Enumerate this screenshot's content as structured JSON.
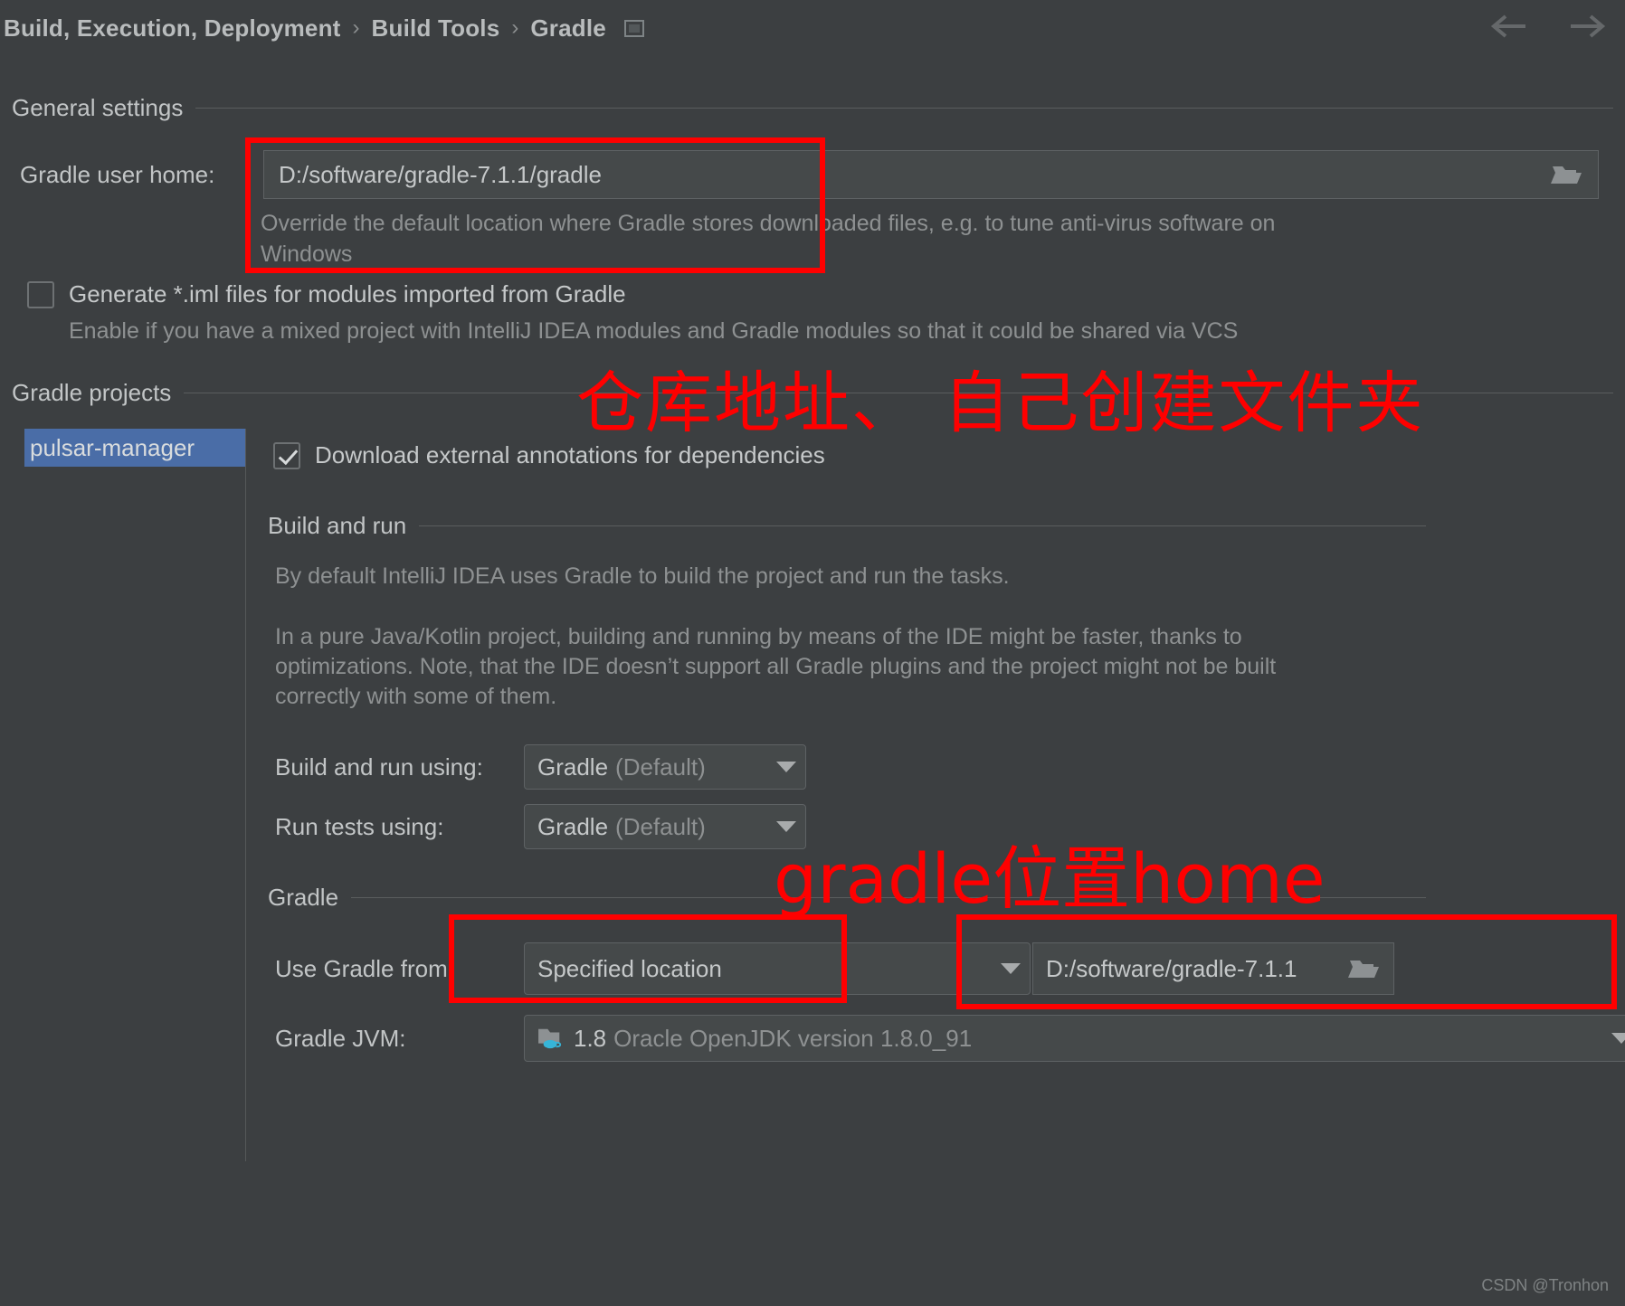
{
  "breadcrumb": {
    "items": [
      "Build, Execution, Deployment",
      "Build Tools",
      "Gradle"
    ],
    "separator": "›",
    "window_icon": "window-icon"
  },
  "nav": {
    "back_icon": "arrow-left-icon",
    "forward_icon": "arrow-right-icon"
  },
  "general_settings": {
    "title": "General settings",
    "gradle_user_home": {
      "label": "Gradle user home:",
      "value": "D:/software/gradle-7.1.1/gradle",
      "browse_icon": "folder-icon",
      "hint": "Override the default location where Gradle stores downloaded files, e.g. to tune anti-virus software on Windows"
    },
    "generate_iml": {
      "label": "Generate *.iml files for modules imported from Gradle",
      "checked": false,
      "hint": "Enable if you have a mixed project with IntelliJ IDEA modules and Gradle modules so that it could be shared via VCS"
    }
  },
  "gradle_projects": {
    "title": "Gradle projects",
    "items": [
      {
        "label": "pulsar-manager",
        "selected": true
      }
    ]
  },
  "right_pane": {
    "download_annotations": {
      "label": "Download external annotations for dependencies",
      "checked": true
    },
    "build_and_run": {
      "title": "Build and run",
      "paragraph_1": "By default IntelliJ IDEA uses Gradle to build the project and run the tasks.",
      "paragraph_2": "In a pure Java/Kotlin project, building and running by means of the IDE might be faster, thanks to optimizations. Note, that the IDE doesn’t support all Gradle plugins and the project might not be built correctly with some of them.",
      "build_run_using": {
        "label": "Build and run using:",
        "value": "Gradle",
        "value_suffix": "(Default)"
      },
      "run_tests_using": {
        "label": "Run tests using:",
        "value": "Gradle",
        "value_suffix": "(Default)"
      }
    },
    "gradle": {
      "title": "Gradle",
      "use_gradle_from": {
        "label": "Use Gradle from:",
        "value": "Specified location"
      },
      "gradle_home": {
        "value": "D:/software/gradle-7.1.1",
        "browse_icon": "folder-icon"
      },
      "gradle_jvm": {
        "label": "Gradle JVM:",
        "version": "1.8",
        "description": "Oracle OpenJDK version 1.8.0_91",
        "icon": "jdk-folder-icon"
      }
    }
  },
  "annotations": {
    "color": "#ff0000",
    "note_1": "仓库地址、 自己创建文件夹",
    "note_2": "gradle位置home",
    "boxes": [
      "gradle-user-home-field",
      "use-gradle-from-field",
      "gradle-home-path-field"
    ]
  },
  "watermark": {
    "text": "CSDN @Tronhon"
  }
}
